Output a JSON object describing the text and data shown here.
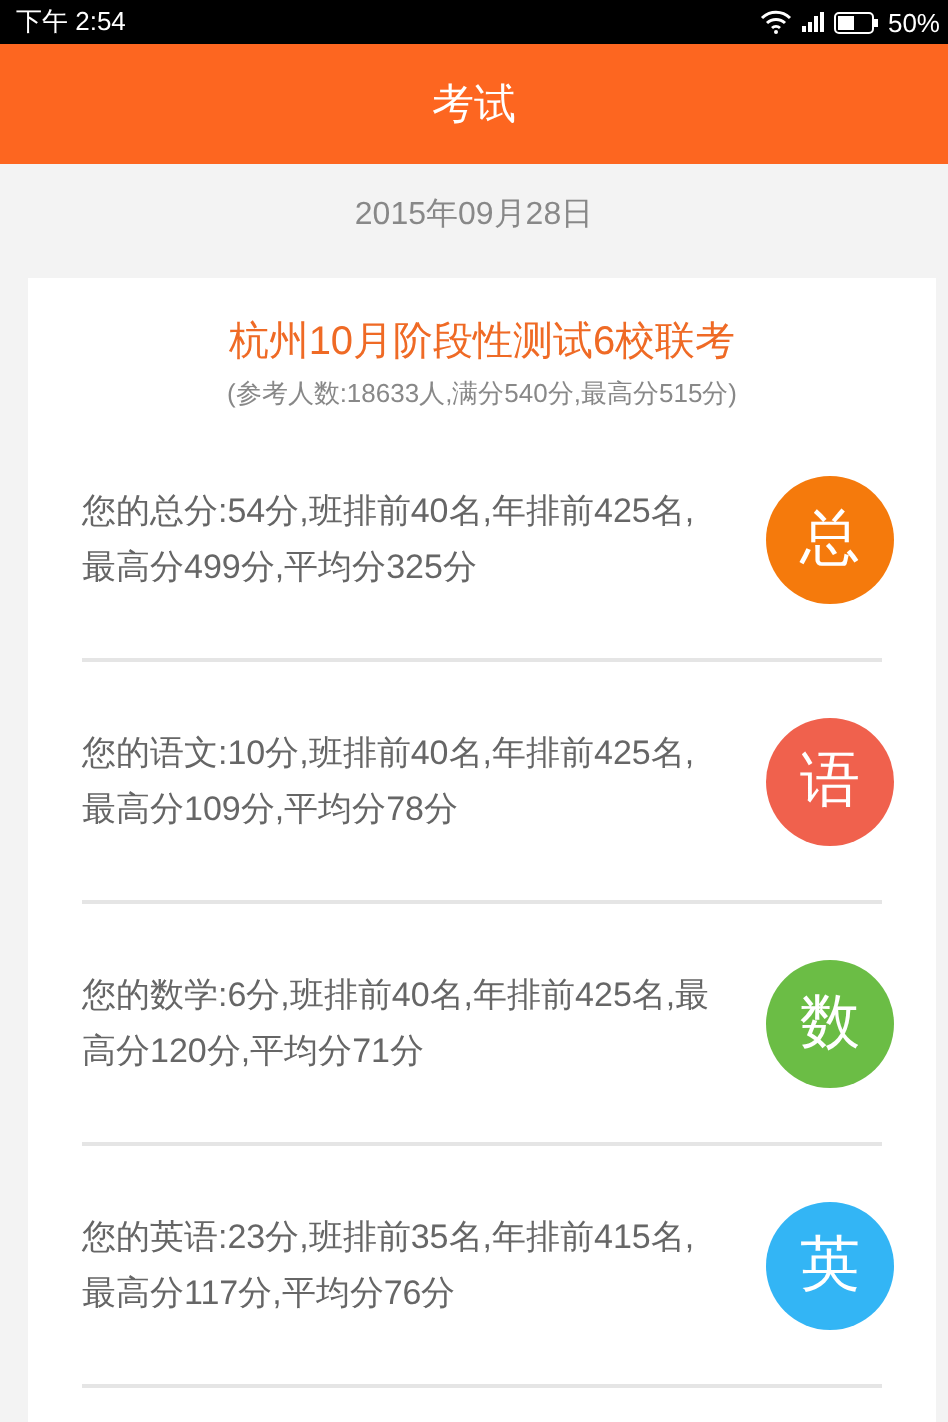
{
  "status_bar": {
    "time": "下午 2:54",
    "battery": "50%"
  },
  "header": {
    "title": "考试"
  },
  "date": "2015年09月28日",
  "exam": {
    "title": "杭州10月阶段性测试6校联考",
    "summary": "(参考人数:18633人,满分540分,最高分515分)"
  },
  "subjects": [
    {
      "text": "您的总分:54分,班排前40名,年排前425名,最高分499分,平均分325分",
      "badge": "总",
      "color": "#f57a0c"
    },
    {
      "text": "您的语文:10分,班排前40名,年排前425名,最高分109分,平均分78分",
      "badge": "语",
      "color": "#f0614d"
    },
    {
      "text": "您的数学:6分,班排前40名,年排前425名,最高分120分,平均分71分",
      "badge": "数",
      "color": "#6bbd45"
    },
    {
      "text": "您的英语:23分,班排前35名,年排前415名,最高分117分,平均分76分",
      "badge": "英",
      "color": "#33b5f5"
    }
  ]
}
